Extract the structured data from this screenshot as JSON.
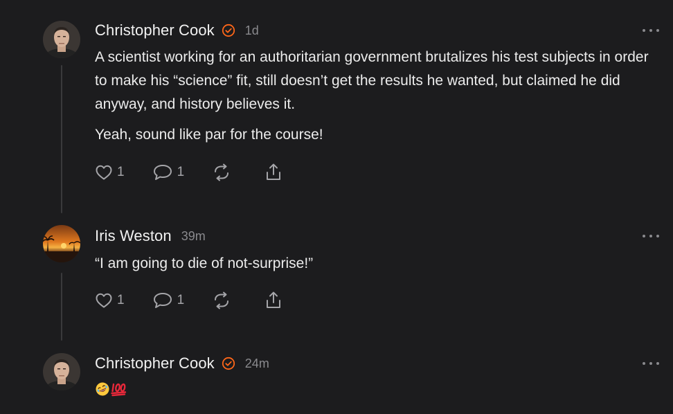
{
  "comments": [
    {
      "author": "Christopher Cook",
      "verified": true,
      "time": "1d",
      "paragraphs": [
        "A scientist working for an authoritarian government brutalizes his test subjects in order to make his “science” fit, still doesn’t get the results he wanted, but claimed he did anyway, and history believes it.",
        "Yeah, sound like par for the course!"
      ],
      "likes": "1",
      "replies": "1"
    },
    {
      "author": "Iris Weston",
      "verified": false,
      "time": "39m",
      "paragraphs": [
        "“I am going to die of not-surprise!”"
      ],
      "likes": "1",
      "replies": "1"
    },
    {
      "author": "Christopher Cook",
      "verified": true,
      "time": "24m",
      "emoji": [
        "rolling-on-the-floor-laughing",
        "hundred-points"
      ]
    }
  ],
  "colors": {
    "background": "#1c1c1e",
    "accent": "#ff6719",
    "muted": "#8a8a8e"
  }
}
